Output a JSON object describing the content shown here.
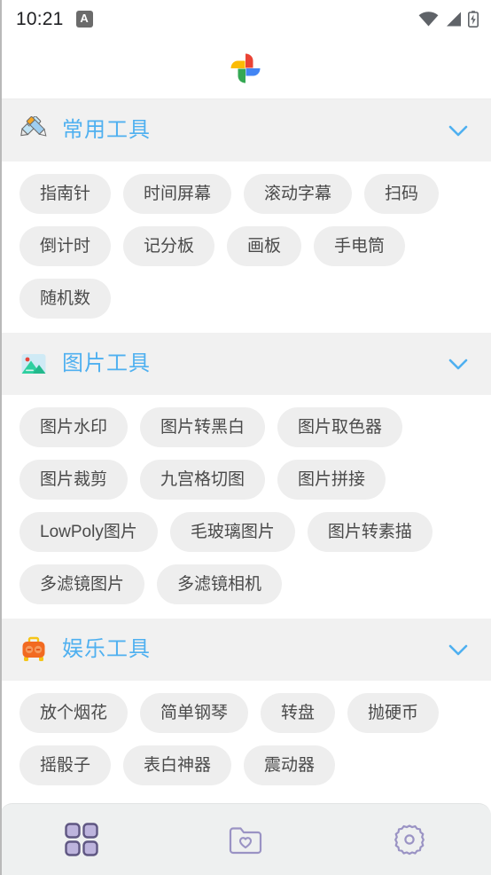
{
  "status_bar": {
    "time": "10:21",
    "notification_badge": "A",
    "icons": [
      "wifi-icon",
      "signal-icon",
      "battery-charging-icon"
    ]
  },
  "header": {
    "logo": "google-photos-pinwheel-logo"
  },
  "sections": [
    {
      "id": "common-tools",
      "title": "常用工具",
      "icon": "pencil-ruler-icon",
      "expanded": true,
      "chevron": "chevron-down-icon",
      "items": [
        "指南针",
        "时间屏幕",
        "滚动字幕",
        "扫码",
        "倒计时",
        "记分板",
        "画板",
        "手电筒",
        "随机数"
      ]
    },
    {
      "id": "image-tools",
      "title": "图片工具",
      "icon": "image-landscape-icon",
      "expanded": true,
      "chevron": "chevron-down-icon",
      "items": [
        "图片水印",
        "图片转黑白",
        "图片取色器",
        "图片裁剪",
        "九宫格切图",
        "图片拼接",
        "LowPoly图片",
        "毛玻璃图片",
        "图片转素描",
        "多滤镜图片",
        "多滤镜相机"
      ]
    },
    {
      "id": "entertainment-tools",
      "title": "娱乐工具",
      "icon": "toy-radio-icon",
      "expanded": true,
      "chevron": "chevron-down-icon",
      "items": [
        "放个烟花",
        "简单钢琴",
        "转盘",
        "抛硬币",
        "摇骰子",
        "表白神器",
        "震动器"
      ]
    }
  ],
  "bottom_nav": {
    "items": [
      {
        "id": "tools",
        "icon": "grid-icon",
        "active": true
      },
      {
        "id": "favorites",
        "icon": "folder-heart-icon",
        "active": false
      },
      {
        "id": "settings",
        "icon": "gear-icon",
        "active": false
      }
    ]
  },
  "colors": {
    "accent_blue": "#4FB0F0",
    "chip_bg": "#eeeeee",
    "section_bg": "#f1f1f1",
    "nav_bg": "#eef0f0",
    "nav_icon": "#9a93c4",
    "nav_icon_active": "#5f5782"
  }
}
